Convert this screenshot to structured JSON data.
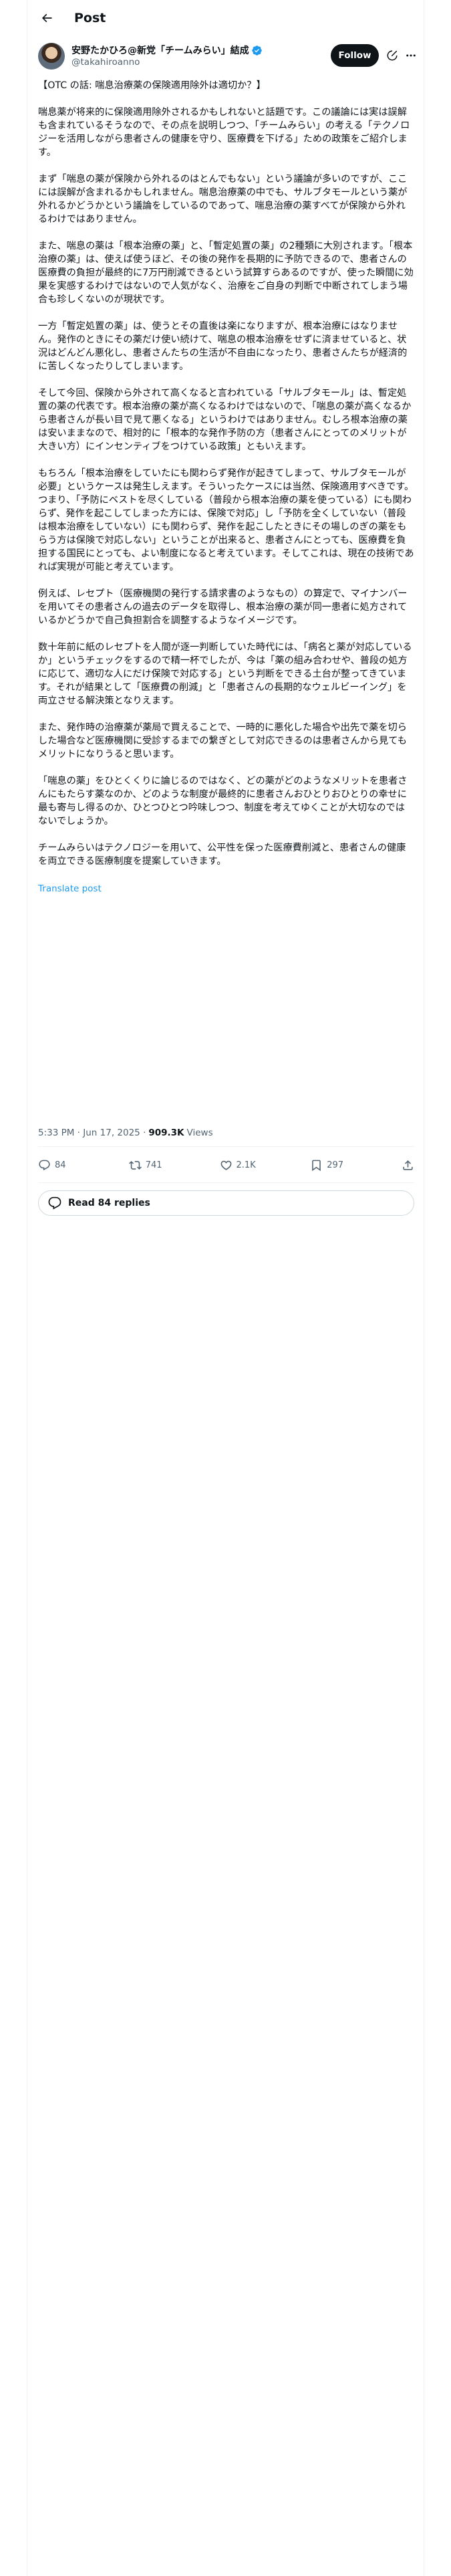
{
  "header": {
    "title": "Post",
    "back_icon": "arrow-left-icon"
  },
  "author": {
    "display_name": "安野たかひろ@新党「チームみらい」結成",
    "handle": "@takahiroanno",
    "verified": true,
    "follow_label": "Follow"
  },
  "post": {
    "paragraphs": [
      "【OTC の話: 喘息治療薬の保険適用除外は適切か？】",
      "喘息薬が将来的に保険適用除外されるかもしれないと話題です。この議論には実は誤解も含まれているそうなので、その点を説明しつつ、「チームみらい」の考える「テクノロジーを活用しながら患者さんの健康を守り、医療費を下げる」ための政策をご紹介します。",
      "まず「喘息の薬が保険から外れるのはとんでもない」という議論が多いのですが、ここには誤解が含まれるかもしれません。喘息治療薬の中でも、サルブタモールという薬が外れるかどうかという議論をしているのであって、喘息治療の薬すべてが保険から外れるわけではありません。",
      "また、喘息の薬は「根本治療の薬」と、「暫定処置の薬」の2種類に大別されます。「根本治療の薬」は、使えば使うほど、その後の発作を長期的に予防できるので、患者さんの医療費の負担が最終的に7万円削減できるという試算すらあるのですが、使った瞬間に効果を実感するわけではないので人気がなく、治療をご自身の判断で中断されてしまう場合も珍しくないのが現状です。",
      "一方「暫定処置の薬」は、使うとその直後は楽になりますが、根本治療にはなりません。発作のときにその薬だけ使い続けて、喘息の根本治療をせずに済ませていると、状況はどんどん悪化し、患者さんたちの生活が不自由になったり、患者さんたちが経済的に苦しくなったりしてしまいます。",
      "そして今回、保険から外されて高くなると言われている「サルブタモール」は、暫定処置の薬の代表です。根本治療の薬が高くなるわけではないので、「喘息の薬が高くなるから患者さんが長い目で見て悪くなる」というわけではありません。むしろ根本治療の薬は安いままなので、相対的に「根本的な発作予防の方（患者さんにとってのメリットが大きい方）にインセンティブをつけている政策」ともいえます。",
      "もちろん「根本治療をしていたにも関わらず発作が起きてしまって、サルブタモールが必要」というケースは発生しえます。そういったケースには当然、保険適用すべきです。つまり、「予防にベストを尽くしている（普段から根本治療の薬を使っている）にも関わらず、発作を起こしてしまった方には、保険で対応」し「予防を全くしていない（普段は根本治療をしていない）にも関わらず、発作を起こしたときにその場しのぎの薬をもらう方は保険で対応しない」ということが出来ると、患者さんにとっても、医療費を負担する国民にとっても、よい制度になると考えています。そしてこれは、現在の技術であれば実現が可能と考えています。",
      "例えば、レセプト（医療機関の発行する請求書のようなもの）の算定で、マイナンバーを用いてその患者さんの過去のデータを取得し、根本治療の薬が同一患者に処方されているかどうかで自己負担割合を調整するようなイメージです。",
      "数十年前に紙のレセプトを人間が逐一判断していた時代には、「病名と薬が対応しているか」というチェックをするので精一杯でしたが、今は「薬の組み合わせや、普段の処方に応じて、適切な人にだけ保険で対応する」という判断をできる土台が整ってきています。それが結果として「医療費の削減」と「患者さんの長期的なウェルビーイング」を両立させる解決策となりえます。",
      "また、発作時の治療薬が薬局で買えることで、一時的に悪化した場合や出先で薬を切らした場合など医療機関に受診するまでの繋ぎとして対応できるのは患者さんから見てもメリットになりうると思います。",
      "「喘息の薬」をひとくくりに論じるのではなく、どの薬がどのようなメリットを患者さんにもたらす薬なのか、どのような制度が最終的に患者さんおひとりおひとりの幸せに最も寄与し得るのか、ひとつひとつ吟味しつつ、制度を考えてゆくことが大切なのではないでしょうか。",
      "チームみらいはテクノロジーを用いて、公平性を保った医療費削減と、患者さんの健康を両立できる医療制度を提案していきます。"
    ],
    "translate_label": "Translate post",
    "timestamp": "5:33 PM · Jun 17, 2025 · ",
    "views_count": "909.3K",
    "views_label": "Views"
  },
  "actions": {
    "replies": {
      "icon": "reply-icon",
      "count": "84"
    },
    "reposts": {
      "icon": "repost-icon",
      "count": "741"
    },
    "likes": {
      "icon": "heart-icon",
      "count": "2.1K"
    },
    "bookmarks": {
      "icon": "bookmark-icon",
      "count": "297"
    },
    "share": {
      "icon": "share-icon"
    }
  },
  "read_replies_label": "Read 84 replies",
  "colors": {
    "accent": "#1d9bf0",
    "text": "#0f1419",
    "muted": "#536471",
    "border": "#eff3f4"
  }
}
